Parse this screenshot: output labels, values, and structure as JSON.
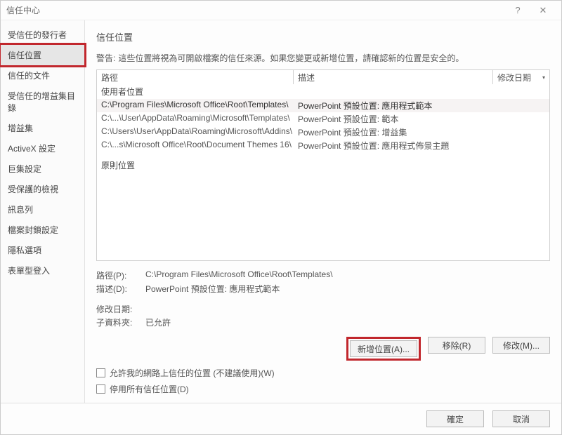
{
  "window": {
    "title": "信任中心"
  },
  "sidebar": {
    "items": [
      {
        "label": "受信任的發行者"
      },
      {
        "label": "信任位置"
      },
      {
        "label": "信任的文件"
      },
      {
        "label": "受信任的增益集目錄"
      },
      {
        "label": "增益集"
      },
      {
        "label": "ActiveX 設定"
      },
      {
        "label": "巨集設定"
      },
      {
        "label": "受保護的檢視"
      },
      {
        "label": "訊息列"
      },
      {
        "label": "檔案封鎖設定"
      },
      {
        "label": "隱私選項"
      },
      {
        "label": "表單型登入"
      }
    ]
  },
  "main": {
    "heading": "信任位置",
    "warn_label": "警告:",
    "warn_text": "這些位置將視為可開啟檔案的信任來源。如果您變更或新增位置，請確認新的位置是安全的。",
    "columns": {
      "path": "路徑",
      "desc": "描述",
      "date": "修改日期"
    },
    "section_user": "使用者位置",
    "section_policy": "原則位置",
    "rows": [
      {
        "path": "C:\\Program Files\\Microsoft Office\\Root\\Templates\\",
        "desc": "PowerPoint 預設位置: 應用程式範本"
      },
      {
        "path": "C:\\...\\User\\AppData\\Roaming\\Microsoft\\Templates\\",
        "desc": "PowerPoint 預設位置: 範本"
      },
      {
        "path": "C:\\Users\\User\\AppData\\Roaming\\Microsoft\\Addins\\",
        "desc": "PowerPoint 預設位置: 增益集"
      },
      {
        "path": "C:\\...s\\Microsoft Office\\Root\\Document Themes 16\\",
        "desc": "PowerPoint 預設位置: 應用程式佈景主題"
      }
    ],
    "details": {
      "path_label": "路徑(P):",
      "path_value": "C:\\Program Files\\Microsoft Office\\Root\\Templates\\",
      "desc_label": "描述(D):",
      "desc_value": "PowerPoint 預設位置: 應用程式範本",
      "moddate_label": "修改日期:",
      "moddate_value": "",
      "subfolder_label": "子資料夾:",
      "subfolder_value": "已允許"
    },
    "buttons": {
      "add": "新增位置(A)...",
      "remove": "移除(R)",
      "modify": "修改(M)..."
    },
    "checks": {
      "allow_network": "允許我的網路上信任的位置 (不建議使用)(W)",
      "disable_all": "停用所有信任位置(D)"
    }
  },
  "footer": {
    "ok": "確定",
    "cancel": "取消"
  }
}
